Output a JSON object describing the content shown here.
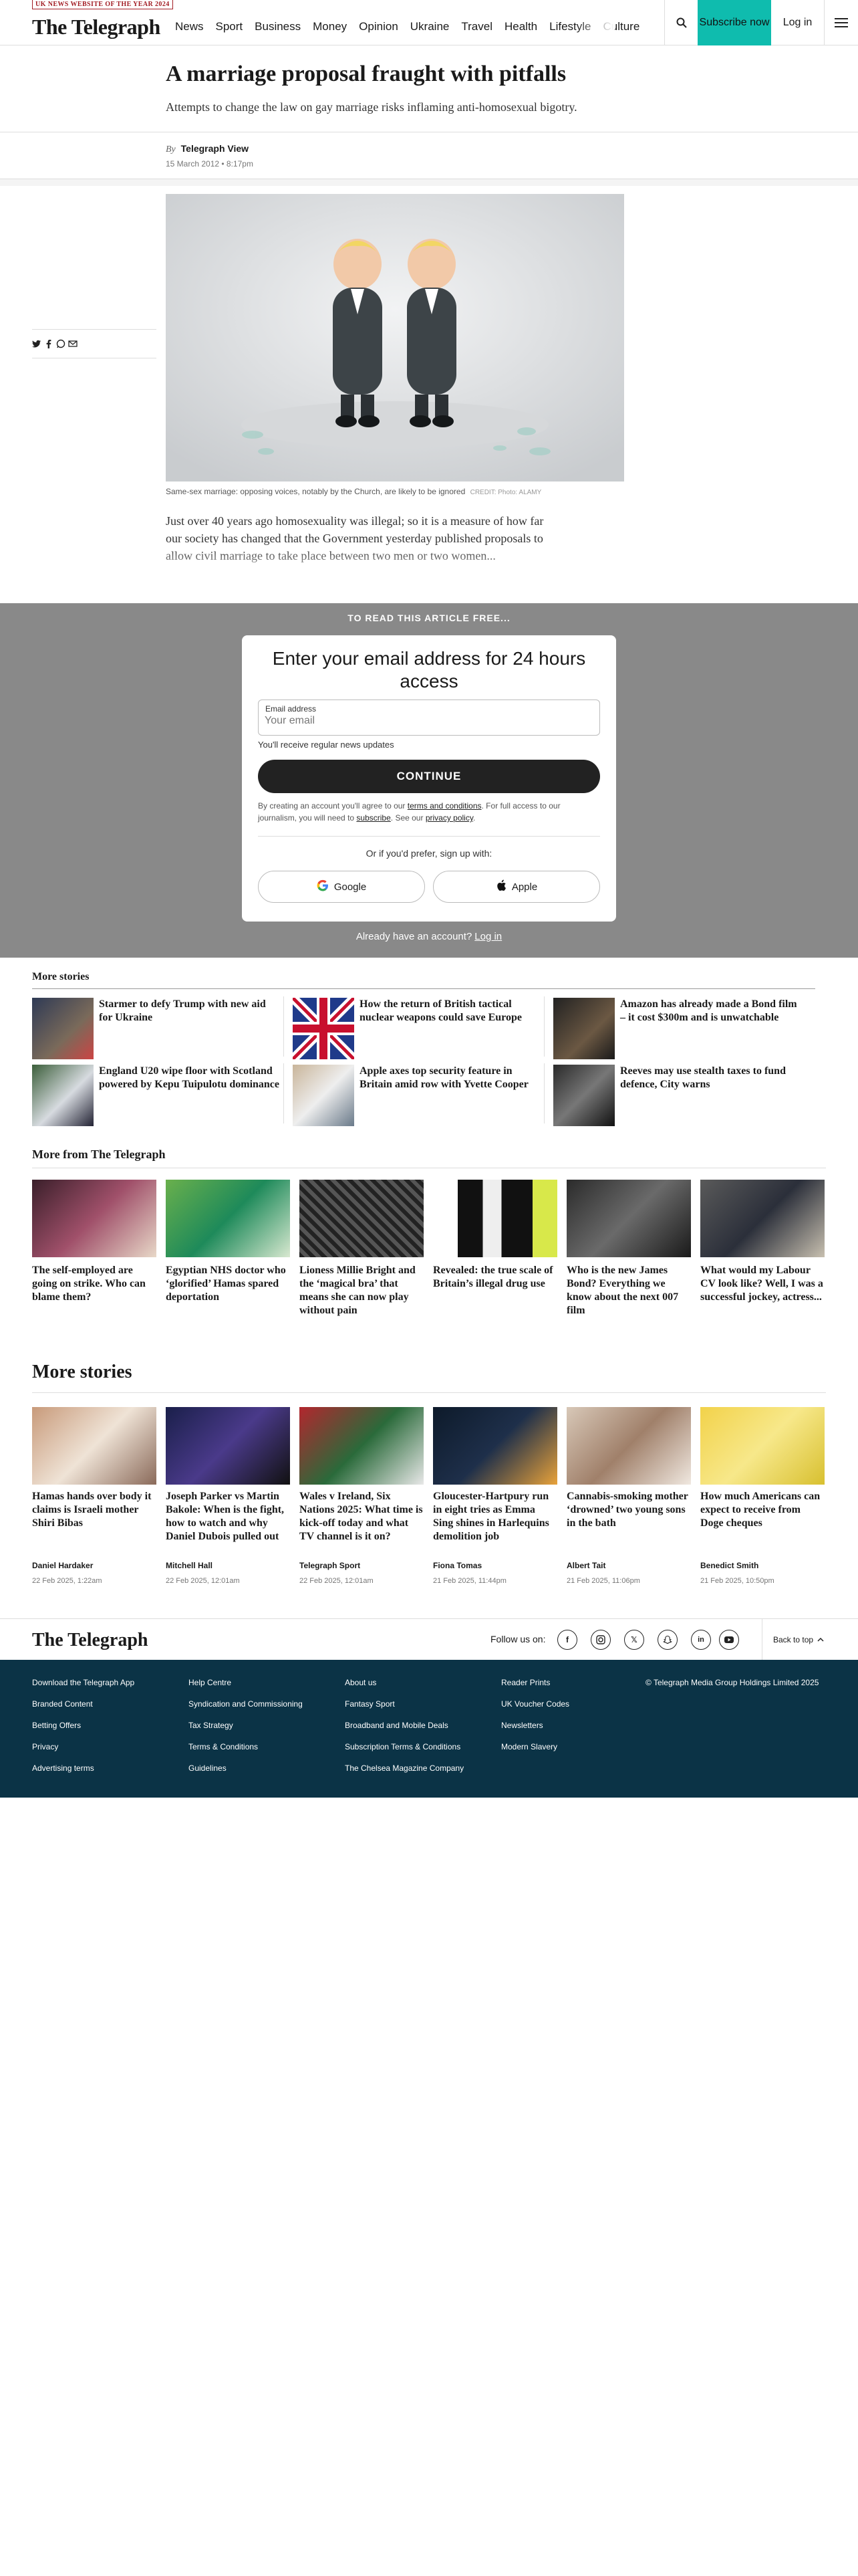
{
  "header": {
    "award": "UK NEWS WEBSITE OF THE YEAR 2024",
    "logo": "The Telegraph",
    "nav": [
      "News",
      "Sport",
      "Business",
      "Money",
      "Opinion",
      "Ukraine",
      "Travel",
      "Health",
      "Lifestyle",
      "Culture"
    ],
    "subscribe": "Subscribe now",
    "login": "Log in"
  },
  "article": {
    "headline": "A marriage proposal fraught with pitfalls",
    "standfirst": "Attempts to change the law on gay marriage risks inflaming anti-homosexual bigotry.",
    "by": "By",
    "author": "Telegraph View",
    "date": "15 March 2012 • 8:17pm",
    "caption": "Same-sex marriage: opposing voices, notably by the Church, are likely to be ignored",
    "credit": "CREDIT: Photo: ALAMY",
    "body": "Just over 40 years ago homosexuality was illegal; so it is a measure of how far our society has changed that the Government yesterday published proposals to allow civil marriage to take place between two men or two women..."
  },
  "paywall": {
    "title": "TO READ THIS ARTICLE FREE...",
    "heading": "Enter your email address for 24 hours access",
    "email_label": "Email address",
    "email_placeholder": "Your email",
    "hint": "You'll receive regular news updates",
    "continue": "CONTINUE",
    "terms_1": "By creating an account you'll agree to our",
    "terms_link": "terms and conditions",
    "terms_2": ". For full access to our journalism, you will need to",
    "subscribe_link": "subscribe",
    "terms_3": ". See our",
    "privacy_link": "privacy policy",
    "or": "Or if you'd prefer, sign up with:",
    "google": "Google",
    "apple": "Apple",
    "have_account": "Already have an account?",
    "login_link": "Log in"
  },
  "more_stories_small": {
    "title": "More stories",
    "items": [
      {
        "title": "Starmer to defy Trump with new aid for Ukraine"
      },
      {
        "title": "How the return of British tactical nuclear weapons could save Europe"
      },
      {
        "title": "Amazon has already made a Bond film – it cost $300m and is unwatchable"
      },
      {
        "title": "England U20 wipe floor with Scotland powered by Kepu Tuipulotu dominance"
      },
      {
        "title": "Apple axes top security feature in Britain amid row with Yvette Cooper"
      },
      {
        "title": "Reeves may use stealth taxes to fund defence, City warns"
      }
    ]
  },
  "more_from": {
    "title": "More from The Telegraph",
    "items": [
      {
        "title": "The self-employed are going on strike. Who can blame them?"
      },
      {
        "title": "Egyptian NHS doctor who ‘glorified’ Hamas spared deportation"
      },
      {
        "title": "Lioness Millie Bright and the ‘magical bra’ that means she can now play without pain"
      },
      {
        "title": "Revealed: the true scale of Britain’s illegal drug use"
      },
      {
        "title": "Who is the new James Bond? Everything we know about the next 007 film"
      },
      {
        "title": "What would my Labour CV look like? Well, I was a successful jockey, actress..."
      }
    ]
  },
  "more_stories": {
    "title": "More stories",
    "items": [
      {
        "title": "Hamas hands over body it claims is Israeli mother Shiri Bibas",
        "author": "Daniel Hardaker",
        "date": "22 Feb 2025, 1:22am"
      },
      {
        "title": "Joseph Parker vs Martin Bakole: When is the fight, how to watch and why Daniel Dubois pulled out",
        "author": "Mitchell Hall",
        "date": "22 Feb 2025, 12:01am"
      },
      {
        "title": "Wales v Ireland, Six Nations 2025: What time is kick-off today and what TV channel is it on?",
        "author": "Telegraph Sport",
        "date": "22 Feb 2025, 12:01am"
      },
      {
        "title": "Gloucester-Hartpury run in eight tries as Emma Sing shines in Harlequins demolition job",
        "author": "Fiona Tomas",
        "date": "21 Feb 2025, 11:44pm"
      },
      {
        "title": "Cannabis-smoking mother ‘drowned’ two young sons in the bath",
        "author": "Albert Tait",
        "date": "21 Feb 2025, 11:06pm"
      },
      {
        "title": "How much Americans can expect to receive from Doge cheques",
        "author": "Benedict Smith",
        "date": "21 Feb 2025, 10:50pm"
      }
    ]
  },
  "footer": {
    "logo": "The Telegraph",
    "follow": "Follow us on:",
    "back_to_top": "Back to top",
    "col1": [
      "Download the Telegraph App",
      "Branded Content",
      "Betting Offers",
      "Privacy",
      "Advertising terms"
    ],
    "col2": [
      "Help Centre",
      "Syndication and Commissioning",
      "Tax Strategy",
      "Terms & Conditions",
      "Guidelines"
    ],
    "col3": [
      "About us",
      "Fantasy Sport",
      "Broadband and Mobile Deals",
      "Subscription Terms & Conditions",
      "The Chelsea Magazine Company"
    ],
    "col4": [
      "Reader Prints",
      "UK Voucher Codes",
      "Newsletters",
      "Modern Slavery"
    ],
    "copyright": "© Telegraph Media Group Holdings Limited 2025"
  }
}
